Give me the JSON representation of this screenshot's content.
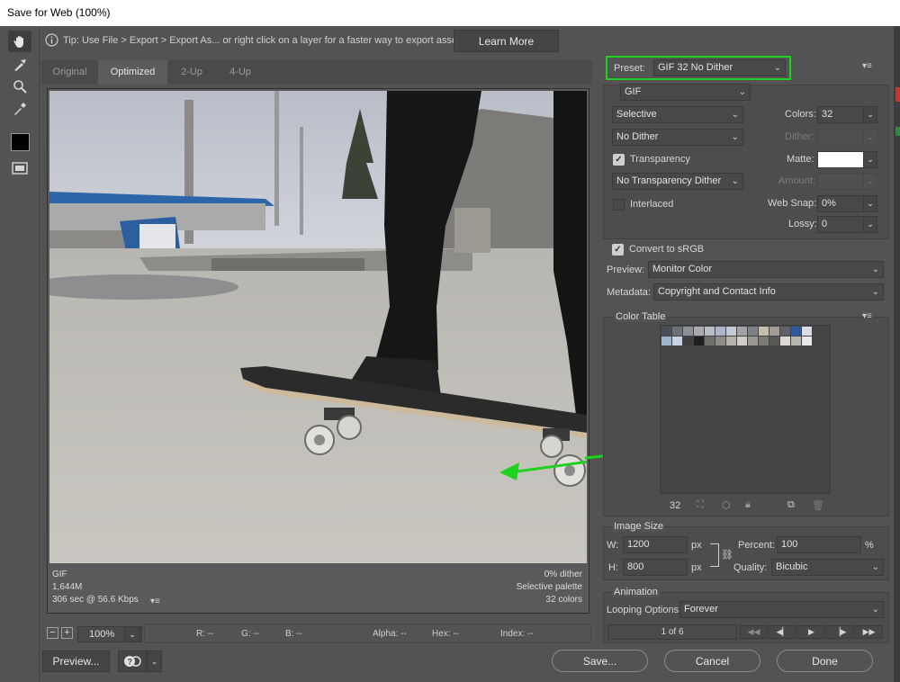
{
  "window": {
    "title": "Save for Web (100%)"
  },
  "tip": {
    "text": "Tip: Use File > Export > Export As...  or right click on a layer for a faster way to export assets",
    "learn_more": "Learn More"
  },
  "tabs": [
    {
      "label": "Original"
    },
    {
      "label": "Optimized"
    },
    {
      "label": "2-Up"
    },
    {
      "label": "4-Up"
    }
  ],
  "image_info": {
    "format": "GIF",
    "size": "1,644M",
    "time": "306 sec @ 56.6 Kbps",
    "dither": "0% dither",
    "palette": "Selective palette",
    "colors": "32 colors"
  },
  "zoom": {
    "value": "100%"
  },
  "readouts": {
    "r": "R: --",
    "g": "G: --",
    "b": "B: --",
    "alpha": "Alpha: --",
    "hex": "Hex: --",
    "index": "Index: --"
  },
  "buttons": {
    "preview": "Preview...",
    "save": "Save...",
    "cancel": "Cancel",
    "done": "Done"
  },
  "preset": {
    "label": "Preset:",
    "value": "GIF 32 No Dither"
  },
  "settings": {
    "format": "GIF",
    "reduction": "Selective",
    "dither_algo": "No Dither",
    "transparency_label": "Transparency",
    "transparency_checked": true,
    "transparency_dither": "No Transparency Dither",
    "interlaced_label": "Interlaced",
    "interlaced_checked": false,
    "colors_label": "Colors:",
    "colors_value": "32",
    "dither_label": "Dither:",
    "matte_label": "Matte:",
    "amount_label": "Amount:",
    "websnap_label": "Web Snap:",
    "websnap_value": "0%",
    "lossy_label": "Lossy:",
    "lossy_value": "0",
    "convert_label": "Convert to sRGB",
    "convert_checked": true,
    "preview_label": "Preview:",
    "preview_value": "Monitor Color",
    "metadata_label": "Metadata:",
    "metadata_value": "Copyright and Contact Info"
  },
  "color_table": {
    "title": "Color Table",
    "count": "32",
    "swatches_row1": [
      "#4a4f57",
      "#6c7077",
      "#8d9097",
      "#a7aab0",
      "#b9bcc2",
      "#a8b7cf",
      "#c3cad6",
      "#9fa2a6",
      "#7d8186",
      "#c9bda8",
      "#a19c95",
      "#5d6169",
      "#2a5aa0",
      "#d7dde6"
    ],
    "swatches_row2": [
      "#9eb3d1",
      "#c6d4e6",
      "#3d3f42",
      "#1e1f21",
      "#6f6e6a",
      "#8e8c86",
      "#b4b2ab",
      "#cfcdc6",
      "#9a978f",
      "#7b7a75",
      "#585754",
      "#dcdad3",
      "#b7b5ae",
      "#e8e8e8"
    ]
  },
  "image_size": {
    "title": "Image Size",
    "w_label": "W:",
    "w_value": "1200",
    "w_unit": "px",
    "h_label": "H:",
    "h_value": "800",
    "h_unit": "px",
    "percent_label": "Percent:",
    "percent_value": "100",
    "percent_unit": "%",
    "quality_label": "Quality:",
    "quality_value": "Bicubic"
  },
  "animation": {
    "title": "Animation",
    "looping_label": "Looping Options:",
    "looping_value": "Forever",
    "frame": "1 of 6"
  },
  "colors": {
    "accent_green": "#1fd11f",
    "panel_bg": "#535353"
  }
}
